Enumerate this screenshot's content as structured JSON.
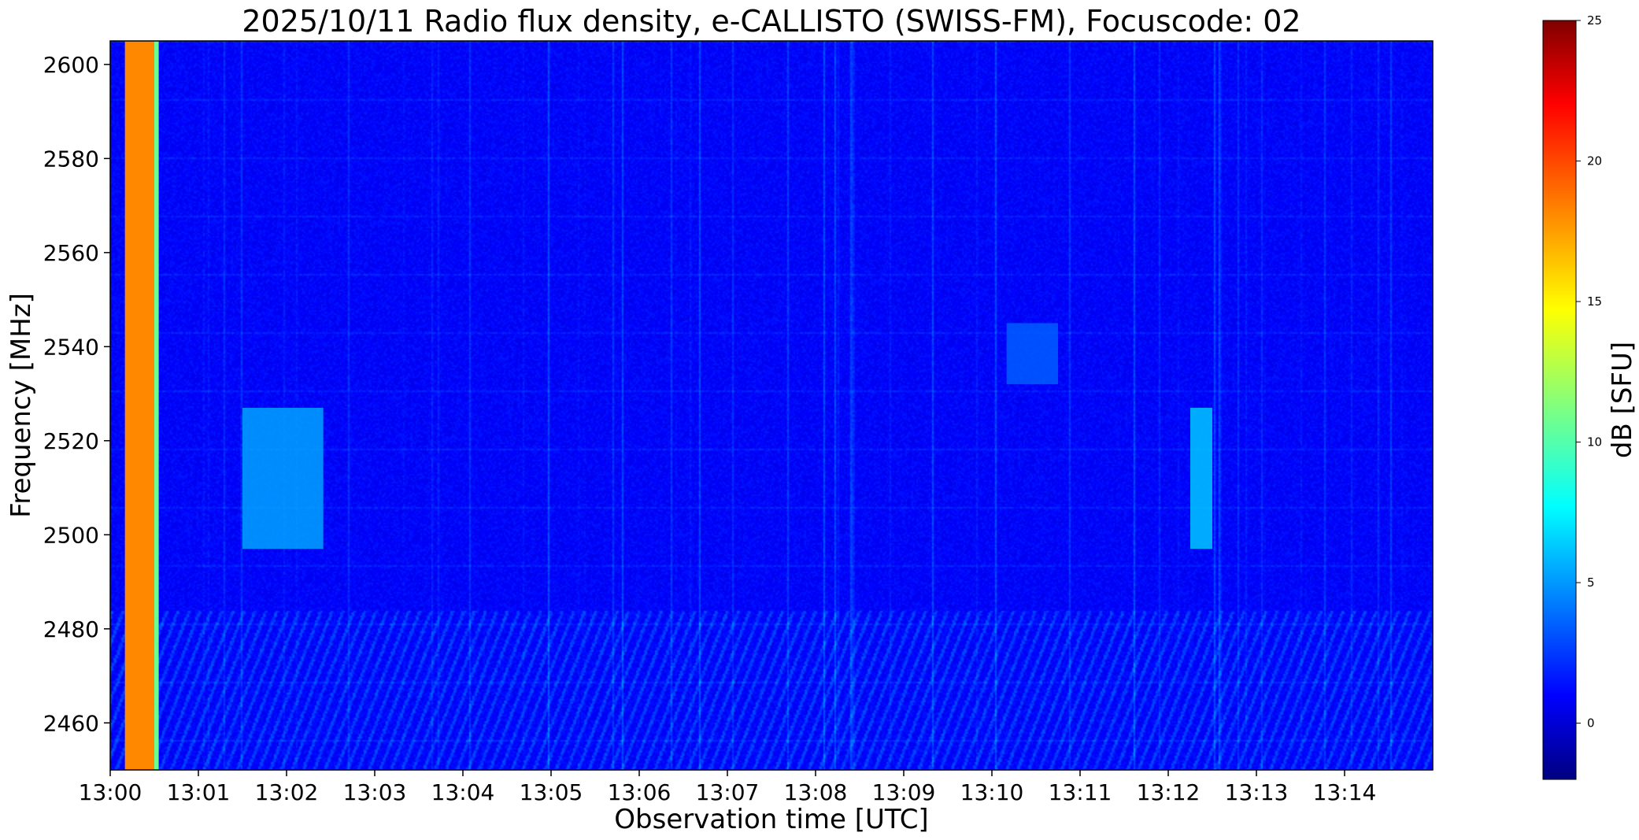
{
  "chart_data": {
    "type": "heatmap",
    "title": "2025/10/11  Radio flux density, e-CALLISTO (SWISS-FM), Focuscode: 02",
    "xlabel": "Observation time [UTC]",
    "ylabel": "Frequency [MHz]",
    "x_ticks": [
      "13:00",
      "13:01",
      "13:02",
      "13:03",
      "13:04",
      "13:05",
      "13:06",
      "13:07",
      "13:08",
      "13:09",
      "13:10",
      "13:11",
      "13:12",
      "13:13",
      "13:14"
    ],
    "xlim": [
      "13:00",
      "13:15"
    ],
    "y_ticks": [
      2460,
      2480,
      2500,
      2520,
      2540,
      2560,
      2580,
      2600
    ],
    "ylim": [
      2450,
      2605
    ],
    "colorbar": {
      "label": "dB [SFU]",
      "ticks": [
        0,
        5,
        10,
        15,
        20,
        25
      ],
      "range": [
        -2,
        25
      ],
      "colormap": "jet"
    },
    "features": [
      {
        "description": "calibration",
        "time_start": "13:00:10",
        "time_end": "13:00:30",
        "freq_range": [
          2450,
          2605
        ],
        "level_db": 18
      },
      {
        "description": "calibration",
        "time_start": "13:00:30",
        "time_end": "13:00:33",
        "freq_range": [
          2450,
          2605
        ],
        "level_db": 11
      },
      {
        "description": "burst",
        "time_start": "13:01:30",
        "time_end": "13:02:25",
        "freq_range": [
          2497,
          2527
        ],
        "level_db": 6
      },
      {
        "description": "burst",
        "time_start": "13:12:15",
        "time_end": "13:12:30",
        "freq_range": [
          2497,
          2527
        ],
        "level_db": 7
      },
      {
        "description": "emission",
        "time_start": "13:10:10",
        "time_end": "13:10:45",
        "freq_range": [
          2532,
          2545
        ],
        "level_db": 4
      }
    ]
  }
}
